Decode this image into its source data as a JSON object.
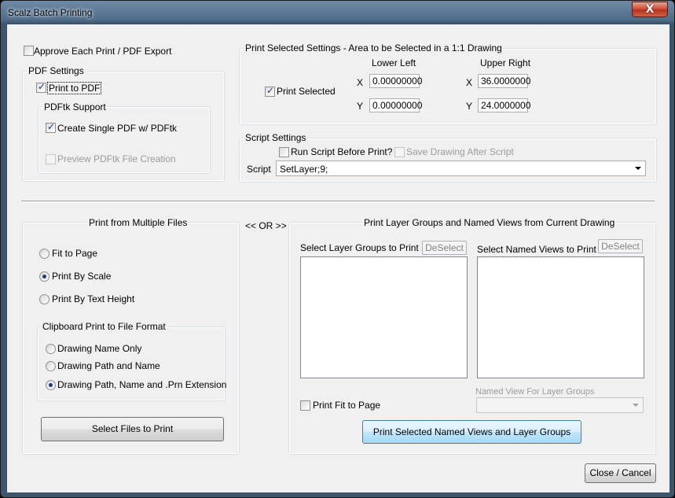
{
  "window": {
    "title": "Scalz Batch Printing",
    "close_glyph": "X"
  },
  "top_left": {
    "approve_label": "Approve Each Print / PDF Export",
    "pdf_group": "PDF Settings",
    "print_to_pdf": "Print to PDF",
    "pdftk_group": "PDFtk Support",
    "create_single_pdf": "Create Single PDF w/ PDFtk",
    "preview_pdftk": "Preview PDFtk File Creation"
  },
  "print_selected": {
    "group": "Print Selected Settings - Area to be Selected in a 1:1 Drawing",
    "lower_left": "Lower Left",
    "upper_right": "Upper Right",
    "checkbox": "Print Selected",
    "x_label": "X",
    "y_label": "Y",
    "ll_x": "0.00000000",
    "ll_y": "0.00000000",
    "ur_x": "36.0000000",
    "ur_y": "24.0000000"
  },
  "script": {
    "group": "Script Settings",
    "run_before": "Run Script Before Print?",
    "save_after": "Save Drawing After Script",
    "label": "Script",
    "value": "SetLayer;9;"
  },
  "multi": {
    "group": "Print from Multiple Files",
    "fit_to_page": "Fit to Page",
    "by_scale": "Print By Scale",
    "by_text_height": "Print By Text Height",
    "clipboard_group": "Clipboard Print to File Format",
    "name_only": "Drawing Name Only",
    "path_and_name": "Drawing Path and Name",
    "path_name_ext": "Drawing Path, Name and .Prn Extension",
    "select_files": "Select Files to Print"
  },
  "or_label": "<< OR >>",
  "layers": {
    "group": "Print Layer Groups and Named Views from Current Drawing",
    "select_groups": "Select Layer Groups to Print",
    "deselect": "DeSelect",
    "select_views": "Select Named Views to Print",
    "print_fit": "Print Fit to Page",
    "named_view_label": "Named View For Layer Groups",
    "print_button": "Print Selected Named Views and Layer Groups"
  },
  "close_cancel": "Close / Cancel"
}
